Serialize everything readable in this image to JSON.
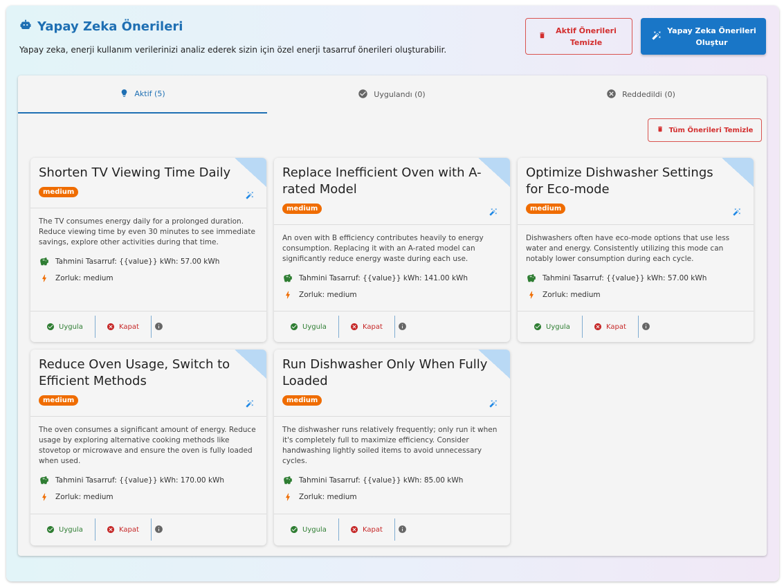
{
  "header": {
    "title": "Yapay Zeka Önerileri",
    "subtitle": "Yapay zeka, enerji kullanım verilerinizi analiz ederek sizin için özel enerji tasarruf önerileri oluşturabilir.",
    "clear_active_label": "Aktif Önerileri Temizle",
    "generate_label": "Yapay Zeka Önerileri Oluştur"
  },
  "tabs": [
    {
      "label": "Aktif (5)",
      "icon": "lightbulb-icon"
    },
    {
      "label": "Uygulandı (0)",
      "icon": "check-circle-icon"
    },
    {
      "label": "Reddedildi (0)",
      "icon": "cancel-circle-icon"
    }
  ],
  "clear_all_label": "Tüm Önerileri Temizle",
  "action_labels": {
    "apply": "Uygula",
    "dismiss": "Kapat"
  },
  "cards": [
    {
      "title": "Shorten TV Viewing Time Daily",
      "badge": "medium",
      "description": "The TV consumes energy daily for a prolonged duration. Reduce viewing time by even 30 minutes to see immediate savings, explore other activities during that time.",
      "savings": "Tahmini Tasarruf: {{value}} kWh: 57.00 kWh",
      "difficulty": "Zorluk: medium"
    },
    {
      "title": "Replace Inefficient Oven with A-rated Model",
      "badge": "medium",
      "description": "An oven with B efficiency contributes heavily to energy consumption. Replacing it with an A-rated model can significantly reduce energy waste during each use.",
      "savings": "Tahmini Tasarruf: {{value}} kWh: 141.00 kWh",
      "difficulty": "Zorluk: medium"
    },
    {
      "title": "Optimize Dishwasher Settings for Eco-mode",
      "badge": "medium",
      "description": "Dishwashers often have eco-mode options that use less water and energy. Consistently utilizing this mode can notably lower consumption during each cycle.",
      "savings": "Tahmini Tasarruf: {{value}} kWh: 57.00 kWh",
      "difficulty": "Zorluk: medium"
    },
    {
      "title": "Reduce Oven Usage, Switch to Efficient Methods",
      "badge": "medium",
      "description": "The oven consumes a significant amount of energy. Reduce usage by exploring alternative cooking methods like stovetop or microwave and ensure the oven is fully loaded when used.",
      "savings": "Tahmini Tasarruf: {{value}} kWh: 170.00 kWh",
      "difficulty": "Zorluk: medium"
    },
    {
      "title": "Run Dishwasher Only When Fully Loaded",
      "badge": "medium",
      "description": "The dishwasher runs relatively frequently; only run it when it's completely full to maximize efficiency. Consider handwashing lightly soiled items to avoid unnecessary cycles.",
      "savings": "Tahmini Tasarruf: {{value}} kWh: 85.00 kWh",
      "difficulty": "Zorluk: medium"
    }
  ]
}
